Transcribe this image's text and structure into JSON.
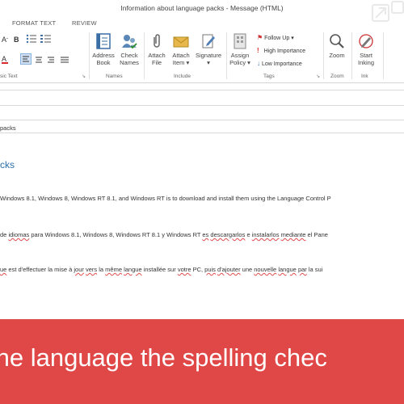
{
  "window": {
    "title": "Information about language packs - Message (HTML)"
  },
  "tabs": [
    {
      "label": "FORMAT TEXT"
    },
    {
      "label": "REVIEW"
    }
  ],
  "ribbon": {
    "groups": {
      "basic_text": "sic Text",
      "names": "Names",
      "include": "Include",
      "tags": "Tags",
      "zoom": "Zoom",
      "ink": "Ink"
    },
    "buttons": {
      "address_book": [
        "Address",
        "Book"
      ],
      "check_names": [
        "Check",
        "Names"
      ],
      "attach_file": [
        "Attach",
        "File"
      ],
      "attach_item": [
        "Attach",
        "Item ▾"
      ],
      "signature": [
        "Signature",
        "▾"
      ],
      "assign_policy": [
        "Assign",
        "Policy ▾"
      ],
      "zoom": [
        "Zoom",
        ""
      ],
      "start_inking": [
        "Start",
        "Inking"
      ]
    },
    "tags": {
      "follow_up": "Follow Up ▾",
      "high_importance": "High Importance",
      "low_importance": "Low Importance"
    }
  },
  "fields": {
    "subject_value": "packs"
  },
  "body": {
    "heading": "cks",
    "line1": "Windows 8.1, Windows 8, Windows RT 8.1, and Windows RT is to download and install them using the Language Control P",
    "line2": {
      "a": "de ",
      "b": "idiomas",
      "c": " para Windows 8.1, Windows 8, Windows RT 8.1 y Windows RT ",
      "d": "es",
      "e": " ",
      "f": "descargarlos",
      "g": " e ",
      "h": "instalarlos",
      "i": " ",
      "j": "mediante",
      "k": " el Pane"
    },
    "line3": {
      "a": "ue",
      "b": " est d'effectuer la mise à ",
      "c": "jour",
      "d": " ",
      "e": "vers",
      "f": " la ",
      "g": "même",
      "h": " ",
      "i": "langue",
      "j": " installée sur ",
      "k": "votre",
      "l": " PC, ",
      "m": "puis",
      "n": " ",
      "o": "d'ajouter",
      "p": " une ",
      "q": "nouvelle",
      "r": " ",
      "s": "langue",
      "t": " ",
      "u": "par",
      "v": " la sui"
    }
  },
  "banner": {
    "text": "the language the spelling chec",
    "color": "#e04847"
  }
}
